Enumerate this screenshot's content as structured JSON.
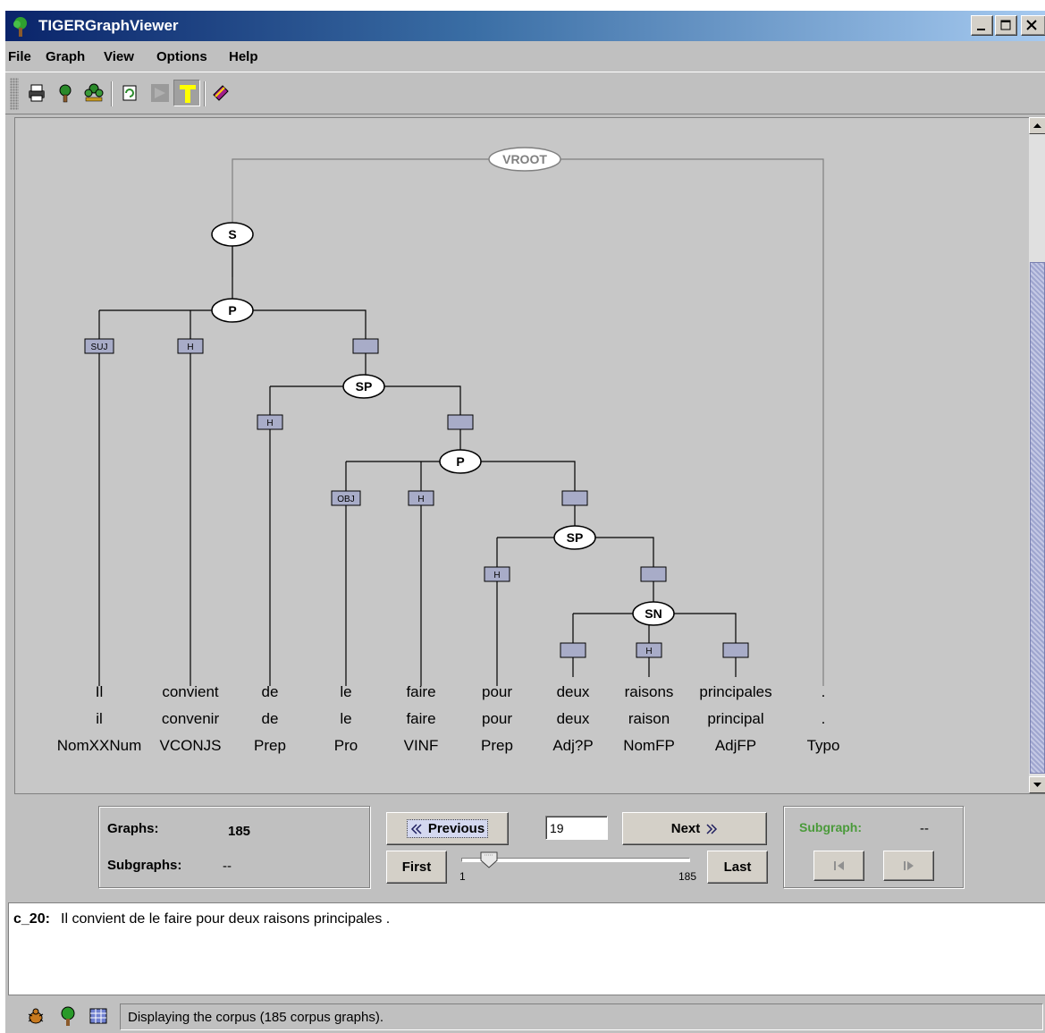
{
  "window": {
    "title": "TIGERGraphViewer"
  },
  "menu": [
    "File",
    "Graph",
    "View",
    "Options",
    "Help"
  ],
  "toolbar": {
    "icons": [
      "print-icon",
      "tree-icon",
      "forest-icon",
      "refresh-icon",
      "disabled-flag-icon",
      "text-T-icon",
      "book-icon"
    ]
  },
  "graph": {
    "nodes": {
      "vroot": "VROOT",
      "s": "S",
      "p1": "P",
      "sp1": "SP",
      "p2": "P",
      "sp2": "SP",
      "sn": "SN"
    },
    "edges": {
      "suj": "SUJ",
      "h1": "H",
      "h2": "H",
      "obj": "OBJ",
      "h3": "H",
      "h4": "H",
      "h5": "H"
    },
    "terminals": [
      {
        "word": "Il",
        "lemma": "il",
        "pos": "NomXXNum"
      },
      {
        "word": "convient",
        "lemma": "convenir",
        "pos": "VCONJS"
      },
      {
        "word": "de",
        "lemma": "de",
        "pos": "Prep"
      },
      {
        "word": "le",
        "lemma": "le",
        "pos": "Pro"
      },
      {
        "word": "faire",
        "lemma": "faire",
        "pos": "VINF"
      },
      {
        "word": "pour",
        "lemma": "pour",
        "pos": "Prep"
      },
      {
        "word": "deux",
        "lemma": "deux",
        "pos": "Adj?P"
      },
      {
        "word": "raisons",
        "lemma": "raison",
        "pos": "NomFP"
      },
      {
        "word": "principales",
        "lemma": "principal",
        "pos": "AdjFP"
      },
      {
        "word": ".",
        "lemma": ".",
        "pos": "Typo"
      }
    ]
  },
  "nav": {
    "graphs_label": "Graphs:",
    "graphs_value": "185",
    "subgraphs_label": "Subgraphs:",
    "subgraphs_value": "--",
    "previous": "Previous",
    "next": "Next",
    "first": "First",
    "last": "Last",
    "current": "19",
    "slider_min": "1",
    "slider_max": "185",
    "slider_value": 19,
    "subgraph_label": "Subgraph:",
    "subgraph_value": "--"
  },
  "sentence": {
    "id": "c_20:",
    "text": "Il convient de le faire pour deux raisons principales ."
  },
  "status": {
    "text": "Displaying the corpus (185 corpus graphs).",
    "icons": [
      "bug-icon",
      "tree-icon",
      "table-icon"
    ]
  },
  "colors": {
    "edge_box": "#a8acc8",
    "subgraph_label": "#4a9a3a",
    "canvas": "#c7c7c7"
  }
}
